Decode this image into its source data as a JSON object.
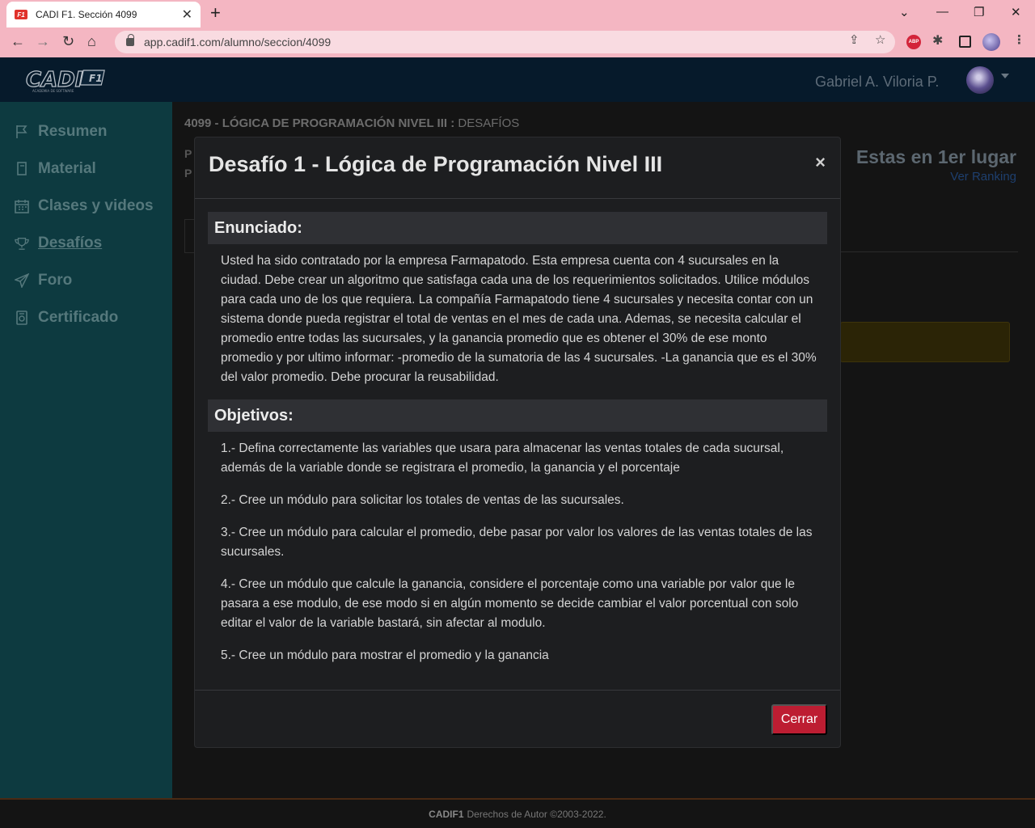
{
  "browser": {
    "tab_title": "CADI F1. Sección 4099",
    "tab_favicon_text": "F1",
    "url": "app.cadif1.com/alumno/seccion/4099",
    "adblock_label": "ABP"
  },
  "header": {
    "logo_text": "CADI",
    "logo_badge": "F1",
    "logo_tagline": "ACADEMIA DE SOFTWARE",
    "user_name": "Gabriel A. Viloria P."
  },
  "sidebar": {
    "items": [
      {
        "label": "Resumen",
        "icon": "flag-icon"
      },
      {
        "label": "Material",
        "icon": "book-icon"
      },
      {
        "label": "Clases y videos",
        "icon": "calendar-icon"
      },
      {
        "label": "Desafíos",
        "icon": "trophy-icon",
        "active": true
      },
      {
        "label": "Foro",
        "icon": "send-icon"
      },
      {
        "label": "Certificado",
        "icon": "certificate-icon"
      }
    ]
  },
  "main": {
    "breadcrumb_course": "4099 - LÓGICA DE PROGRAMACIÓN NIVEL III",
    "breadcrumb_section": "DESAFÍOS",
    "ranking_title": "Estas en 1er lugar",
    "ranking_link": "Ver Ranking"
  },
  "modal": {
    "title": "Desafío 1 - Lógica de Programación Nivel III",
    "close_symbol": "×",
    "enunciado_heading": "Enunciado:",
    "enunciado_text": "Usted ha sido contratado por la empresa Farmapatodo. Esta empresa cuenta con 4 sucursales en la ciudad. Debe crear un algoritmo que satisfaga cada una de los requerimientos solicitados. Utilice módulos para cada uno de los que requiera. La compañía Farmapatodo tiene 4 sucursales y necesita contar con un sistema donde pueda registrar el total de ventas en el mes de cada una. Ademas, se necesita calcular el promedio entre todas las sucursales, y la ganancia promedio que es obtener el 30% de ese monto promedio y por ultimo informar: -promedio de la sumatoria de las 4 sucursales. -La ganancia que es el 30% del valor promedio. Debe procurar la reusabilidad.",
    "objetivos_heading": "Objetivos:",
    "objetivos": [
      "1.- Defina correctamente las variables que usara para almacenar las ventas totales de cada sucursal, además de la variable donde se registrara el promedio, la ganancia y el porcentaje",
      "2.- Cree un módulo para solicitar los totales de ventas de las sucursales.",
      "3.- Cree un módulo para calcular el promedio, debe pasar por valor los valores de las ventas totales de las sucursales.",
      "4.- Cree un módulo que calcule la ganancia, considere el porcentaje como una variable por valor que le pasara a ese modulo, de ese modo si en algún momento se decide cambiar el valor porcentual con solo editar el valor de la variable bastará, sin afectar al modulo.",
      "5.- Cree un módulo para mostrar el promedio y la ganancia"
    ],
    "close_button": "Cerrar"
  },
  "footer": {
    "brand": "CADIF1",
    "text": "Derechos de Autor ©2003-2022."
  }
}
